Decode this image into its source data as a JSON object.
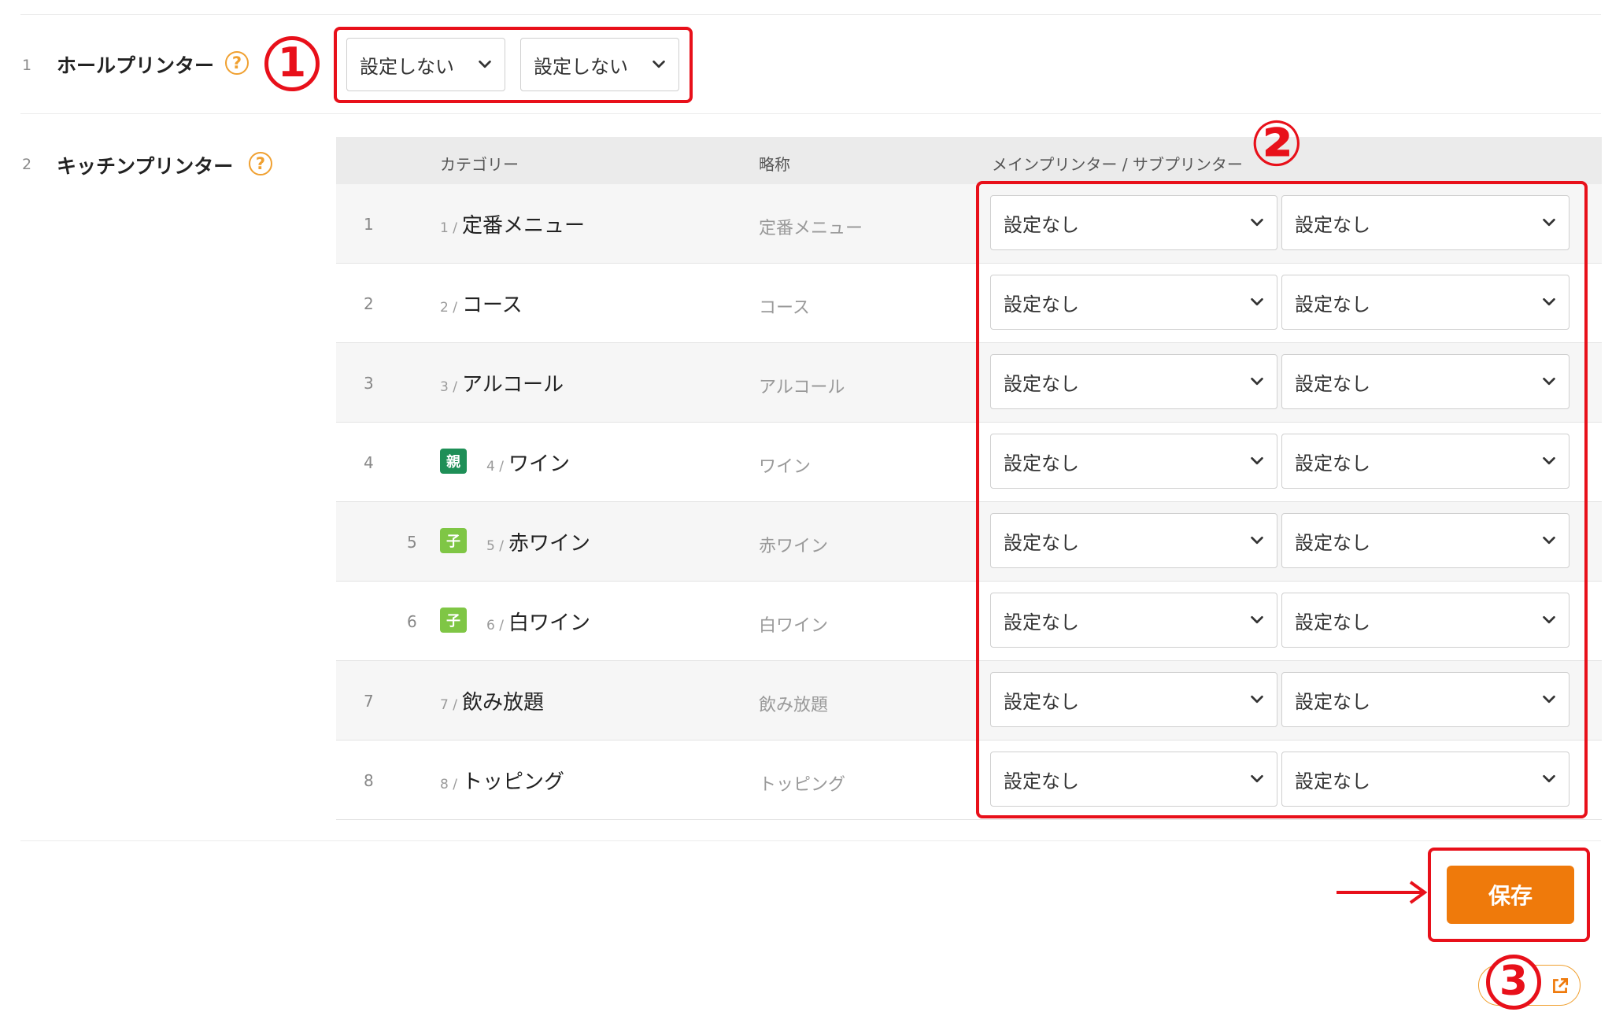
{
  "hall_printer": {
    "row_num": "1",
    "label": "ホールプリンター",
    "help_icon": "?",
    "main_select": "設定しない",
    "sub_select": "設定しない"
  },
  "kitchen_printer": {
    "row_num": "2",
    "label": "キッチンプリンター",
    "help_icon": "?",
    "table": {
      "headers": {
        "category": "カテゴリー",
        "abbr": "略称",
        "printer": "メインプリンター / サブプリンター"
      },
      "rows": [
        {
          "idx": "1",
          "num": "1 /",
          "name": "定番メニュー",
          "abbr": "定番メニュー",
          "badge": "",
          "main": "設定なし",
          "sub": "設定なし"
        },
        {
          "idx": "2",
          "num": "2 /",
          "name": "コース",
          "abbr": "コース",
          "badge": "",
          "main": "設定なし",
          "sub": "設定なし"
        },
        {
          "idx": "3",
          "num": "3 /",
          "name": "アルコール",
          "abbr": "アルコール",
          "badge": "",
          "main": "設定なし",
          "sub": "設定なし"
        },
        {
          "idx": "4",
          "num": "4 /",
          "name": "ワイン",
          "abbr": "ワイン",
          "badge": "親",
          "main": "設定なし",
          "sub": "設定なし"
        },
        {
          "idx": "5",
          "num": "5 /",
          "name": "赤ワイン",
          "abbr": "赤ワイン",
          "badge": "子",
          "main": "設定なし",
          "sub": "設定なし"
        },
        {
          "idx": "6",
          "num": "6 /",
          "name": "白ワイン",
          "abbr": "白ワイン",
          "badge": "子",
          "main": "設定なし",
          "sub": "設定なし"
        },
        {
          "idx": "7",
          "num": "7 /",
          "name": "飲み放題",
          "abbr": "飲み放題",
          "badge": "",
          "main": "設定なし",
          "sub": "設定なし"
        },
        {
          "idx": "8",
          "num": "8 /",
          "name": "トッピング",
          "abbr": "トッピング",
          "badge": "",
          "main": "設定なし",
          "sub": "設定なし"
        }
      ]
    }
  },
  "save_button": "保存",
  "annotations": {
    "one": "①",
    "two": "②",
    "three": "3"
  },
  "colors": {
    "accent": "#ef7a0b",
    "annotation": "#e8101a",
    "parent_badge": "#1e8f57",
    "child_badge": "#7fc645"
  }
}
